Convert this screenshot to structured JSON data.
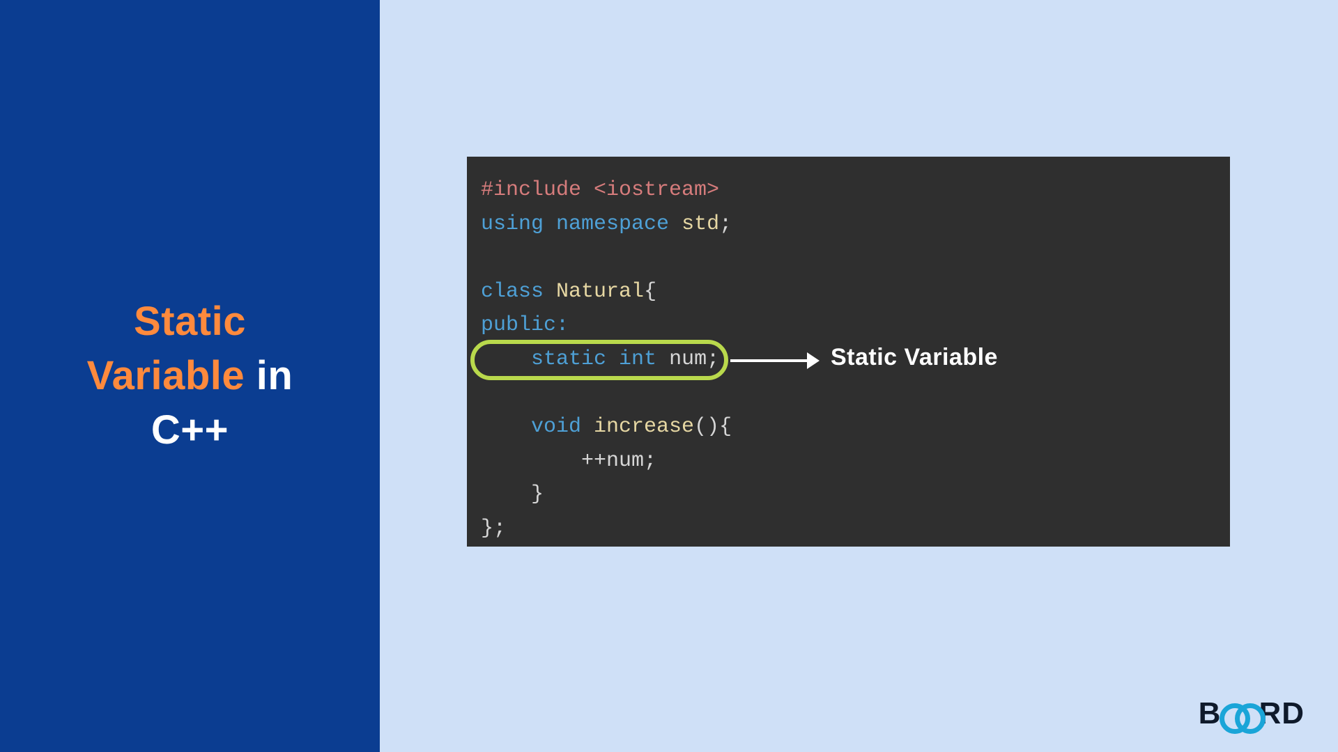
{
  "title": {
    "line1_part1": "Static",
    "line2_part1": "Variable",
    "line2_part2": " in",
    "line3": "C++"
  },
  "code": {
    "include_directive": "#include ",
    "include_header": "<iostream>",
    "using_kw": "using ",
    "namespace_kw": "namespace ",
    "std_ident": "std",
    "semicolon": ";",
    "class_kw": "class ",
    "class_name": "Natural",
    "open_brace": "{",
    "public_kw": "public:",
    "static_kw": "static ",
    "int_kw": "int ",
    "var_name": "num",
    "void_kw": "void ",
    "func_name": "increase",
    "parens_brace": "(){",
    "increment": "++num;",
    "close_brace": "}",
    "class_end": "};"
  },
  "annotation": "Static Variable",
  "logo": {
    "b": "B",
    "rd": "RD"
  }
}
